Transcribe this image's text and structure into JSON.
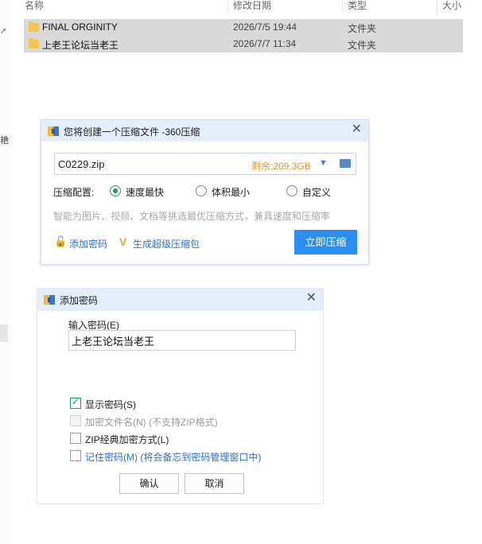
{
  "explorer": {
    "columns": {
      "name": "名称",
      "modified": "修改日期",
      "type": "类型",
      "size": "大小"
    },
    "left_char": "艳",
    "pin_icon": "pin-icon",
    "rows": [
      {
        "name": "FINAL ORGINITY",
        "modified": "2026/7/5 19:44",
        "type": "文件夹"
      },
      {
        "name": "上老王论坛当老王",
        "modified": "2026/7/7 11:34",
        "type": "文件夹"
      }
    ]
  },
  "compress_dialog": {
    "title": "您将创建一个压缩文件 -360压缩",
    "close": "✕",
    "filename": "C0229.zip",
    "space_left": "剩余:209.3GB",
    "config_label": "压缩配置:",
    "options": [
      {
        "label": "速度最快",
        "selected": true
      },
      {
        "label": "体积最小",
        "selected": false
      },
      {
        "label": "自定义",
        "selected": false
      }
    ],
    "hint": "智能为图片、视频、文档等挑选最优压缩方式，兼具速度和压缩率",
    "add_password": "添加密码",
    "super_pack": "生成超级压缩包",
    "compress_now": "立即压缩",
    "accent_color": "#2a8ff0"
  },
  "password_dialog": {
    "title": "添加密码",
    "close": "✕",
    "input_label": "输入密码(E)",
    "password_value": "上老王论坛当老王",
    "checkboxes": [
      {
        "label": "显示密码(S)",
        "checked": true,
        "enabled": true
      },
      {
        "label": "加密文件名(N) (不支持ZIP格式)",
        "checked": false,
        "enabled": false
      },
      {
        "label": "ZIP经典加密方式(L)",
        "checked": false,
        "enabled": true
      },
      {
        "label": "记住密码(M) (将会备忘到密码管理窗口中)",
        "checked": false,
        "enabled": true
      }
    ],
    "ok": "确认",
    "cancel": "取消"
  }
}
